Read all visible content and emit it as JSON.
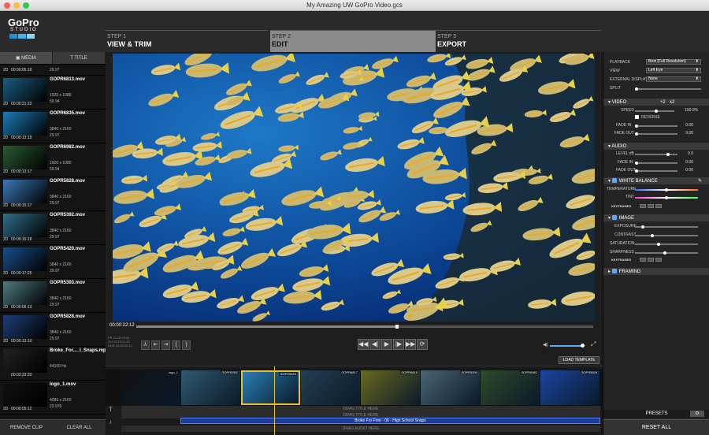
{
  "window": {
    "title": "My Amazing UW GoPro Video.gcs"
  },
  "logo": {
    "line1": "GoPro",
    "line2": "STUDIO"
  },
  "steps": [
    {
      "num": "STEP 1",
      "name": "VIEW & TRIM"
    },
    {
      "num": "STEP 2",
      "name": "EDIT"
    },
    {
      "num": "STEP 3",
      "name": "EXPORT"
    }
  ],
  "left_tabs": {
    "media": "MEDIA",
    "title": "TITLE"
  },
  "first_clip": {
    "format": "2D",
    "duration": "00:00:05:18",
    "fps": "29.97"
  },
  "clips": [
    {
      "name": "GOPR6813.mov",
      "res": "1920 x 1080",
      "fps": "59.94",
      "format": "2D",
      "dur": "00:00:21:22",
      "thumb": "#1c5c80"
    },
    {
      "name": "GOPR6835.mov",
      "res": "3840 x 2160",
      "fps": "29.97",
      "format": "2D",
      "dur": "00:00:13:19",
      "thumb": "#1d7cb8"
    },
    {
      "name": "GOPR6982.mov",
      "res": "1920 x 1080",
      "fps": "59.94",
      "format": "2D",
      "dur": "00:00:13:17",
      "thumb": "#2b5a33"
    },
    {
      "name": "GOPR5828.mov",
      "res": "3840 x 2160",
      "fps": "29.97",
      "format": "2D",
      "dur": "00:00:15:17",
      "thumb": "#3b79b8"
    },
    {
      "name": "GOPR5392.mov",
      "res": "3840 x 2160",
      "fps": "29.97",
      "format": "2D",
      "dur": "00:00:15:18",
      "thumb": "#326f8c"
    },
    {
      "name": "GOPR5420.mov",
      "res": "3840 x 2160",
      "fps": "29.97",
      "format": "2D",
      "dur": "00:00:17:25",
      "thumb": "#1a4f8a"
    },
    {
      "name": "GOPR5393.mov",
      "res": "3840 x 2160",
      "fps": "29.97",
      "format": "2D",
      "dur": "00:00:06:13",
      "thumb": "#4e7a80"
    },
    {
      "name": "GOPR5828.mov",
      "res": "3840 x 2160",
      "fps": "29.97",
      "format": "2D",
      "dur": "00:00:13:10",
      "thumb": "#1f3f7a"
    },
    {
      "name": "Broke_For..._l_Snaps.mp3",
      "res": "44100 Hz",
      "fps": "",
      "format": "",
      "dur": "00:03:33:20",
      "thumb": "#222"
    },
    {
      "name": "logo_1.mov",
      "res": "4096 x 2160",
      "fps": "23.976",
      "format": "2D",
      "dur": "00:00:05:12",
      "thumb": "#101010"
    }
  ],
  "left_buttons": {
    "remove": "REMOVE CLIP",
    "clear": "CLEAR ALL"
  },
  "player": {
    "timecode": "00:00:22:12",
    "info": [
      "PR 11:29:33:54",
      "OU 11:29:11:23",
      "DUR 00:00:22:12"
    ],
    "load_template": "LOAD TEMPLATE",
    "progress": 0.57
  },
  "timeline": {
    "clips": [
      {
        "label": "logo_1",
        "color": "#111"
      },
      {
        "label": "GOPR5392",
        "color": "#2f5a70"
      },
      {
        "label": "GOPR5420",
        "color": "#2b7fb5"
      },
      {
        "label": "GOPR6817",
        "color": "#243e52"
      },
      {
        "label": "GOPR6815",
        "color": "#6a6a20"
      },
      {
        "label": "GOPR5393",
        "color": "#4b6574"
      },
      {
        "label": "GOPR6982",
        "color": "#2f4a2a"
      },
      {
        "label": "GOPR5828",
        "color": "#1b46a0"
      }
    ],
    "title_placeholder": "DRAG TITLE HERE",
    "title_placeholder2": "DRAG TITLE HERE",
    "audio_clip": "Broke For Free - 06 - High School Snaps",
    "audio_placeholder": "DRAG AUDIO HERE"
  },
  "right": {
    "playback_label": "PLAYBACK",
    "playback_value": "Best (Full Resolution)",
    "view_label": "VIEW",
    "view_value": "Left Eye",
    "external_label": "EXTERNAL DISPLAY",
    "external_value": "None",
    "split_label": "SPLIT",
    "video": {
      "header": "VIDEO",
      "ratio1": "÷2",
      "ratio2": "x2",
      "speed_label": "SPEED",
      "speed": "100.0%",
      "reverse": "REVERSE",
      "fadein_label": "FADE IN",
      "fadein": "0.00",
      "fadeout_label": "FADE OUT",
      "fadeout": "0.00"
    },
    "audio": {
      "header": "AUDIO",
      "level_label": "LEVEL dB",
      "level": "0.0",
      "fadein_label": "FADE IN",
      "fadein": "0.00",
      "fadeout_label": "FADE OUT",
      "fadeout": "0.00"
    },
    "wb": {
      "header": "WHITE BALANCE",
      "temp_label": "TEMPERATURE",
      "tint_label": "TINT",
      "keyframes": "KEYFRAMES"
    },
    "image": {
      "header": "IMAGE",
      "exposure": "EXPOSURE",
      "contrast": "CONTRAST",
      "saturation": "SATURATION",
      "sharpness": "SHARPNESS",
      "keyframes": "KEYFRAMES"
    },
    "framing": {
      "header": "FRAMING"
    },
    "presets": "PRESETS",
    "reset_all": "RESET ALL"
  },
  "colors": {
    "accent": "#5aa9ff",
    "playhead": "#e8c229",
    "audio_clip": "#1e3c9e"
  }
}
